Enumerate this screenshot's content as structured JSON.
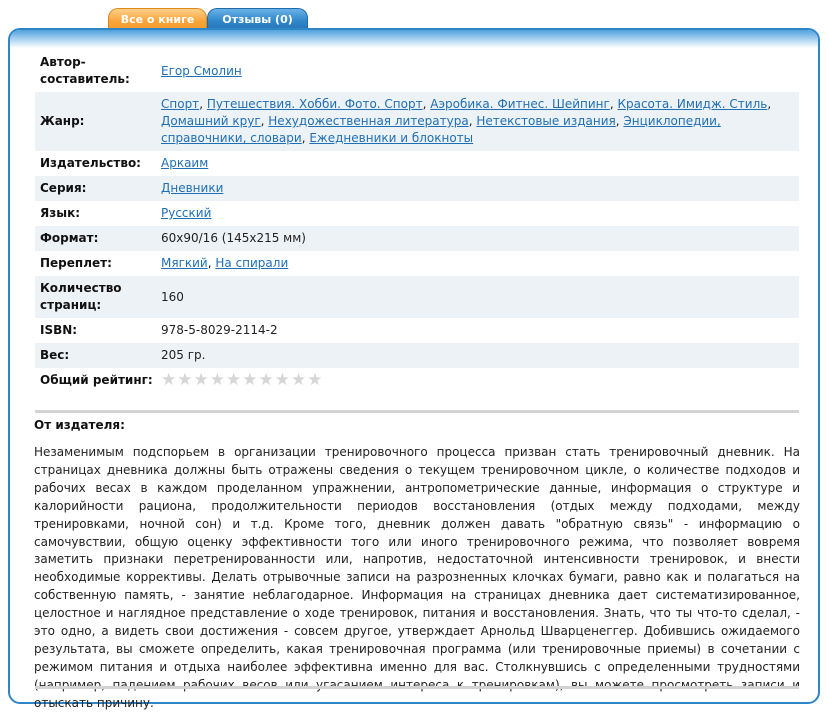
{
  "tabs": {
    "about": "Все о книге",
    "reviews": "Отзывы (0)"
  },
  "info": {
    "author": {
      "label": "Автор-составитель:",
      "value": "Егор Смолин"
    },
    "genre": {
      "label": "Жанр:",
      "links": [
        "Спорт",
        "Путешествия. Хобби. Фото. Спорт",
        "Аэробика. Фитнес. Шейпинг",
        "Красота. Имидж. Стиль",
        "Домашний круг",
        "Нехудожественная литература",
        "Нетекстовые издания",
        "Энциклопедии, справочники, словари",
        "Ежедневники и блокноты"
      ]
    },
    "publisher": {
      "label": "Издательство:",
      "value": "Аркаим"
    },
    "series": {
      "label": "Серия:",
      "value": "Дневники"
    },
    "language": {
      "label": "Язык:",
      "value": "Русский"
    },
    "format": {
      "label": "Формат:",
      "value": "60x90/16 (145x215 мм)"
    },
    "binding": {
      "label": "Переплет:",
      "links": [
        "Мягкий",
        "На спирали"
      ]
    },
    "pages": {
      "label": "Количество страниц:",
      "value": "160"
    },
    "isbn": {
      "label": "ISBN:",
      "value": "978-5-8029-2114-2"
    },
    "weight": {
      "label": "Вес:",
      "value": "205 гр."
    },
    "rating": {
      "label": "Общий рейтинг:",
      "stars_total": 10,
      "stars_filled": 0,
      "star_color": "#d6d6d6"
    }
  },
  "publisher_note": {
    "title": "От издателя:",
    "text": "Незаменимым подспорьем в организации тренировочного процесса призван стать тренировочный дневник. На страницах дневника должны быть отражены сведения о текущем тренировочном цикле, о количестве подходов и рабочих весах в каждом проделанном упражнении, антропометрические данные, информация о структуре и калорийности рациона, продолжительности периодов восстановления (отдых между подходами, между тренировками, ночной сон) и т.д. Кроме того, дневник должен давать \"обратную связь\" - информацию о самочувствии, общую оценку эффективности того или иного тренировочного режима, что позволяет вовремя заметить признаки перетренированности или, напротив, недостаточной интенсивности тренировок, и внести необходимые коррективы. Делать отрывочные записи на разрозненных клочках бумаги, равно как и полагаться на собственную память, - занятие неблагодарное. Информация на страницах дневника дает систематизированное, целостное и наглядное представление о ходе тренировок, питания и восстановления. Знать, что ты что-то сделал, - это одно, а видеть свои достижения - совсем другое, утверждает Арнольд Шварценеггер. Добившись ожидаемого результата, вы сможете определить, какая тренировочная программа (или тренировочные приемы) в сочетании с режимом питания и отдыха наиболее эффективна именно для вас. Столкнувшись с определенными трудностями (например, падением рабочих весов или угасанием интереса к тренировкам), вы можете просмотреть записи и отыскать причину."
  },
  "colors": {
    "accent_blue": "#2e86c8",
    "tab_orange": "#f9a53a",
    "link": "#1f6fb4",
    "row_alt": "#edf2f6"
  }
}
